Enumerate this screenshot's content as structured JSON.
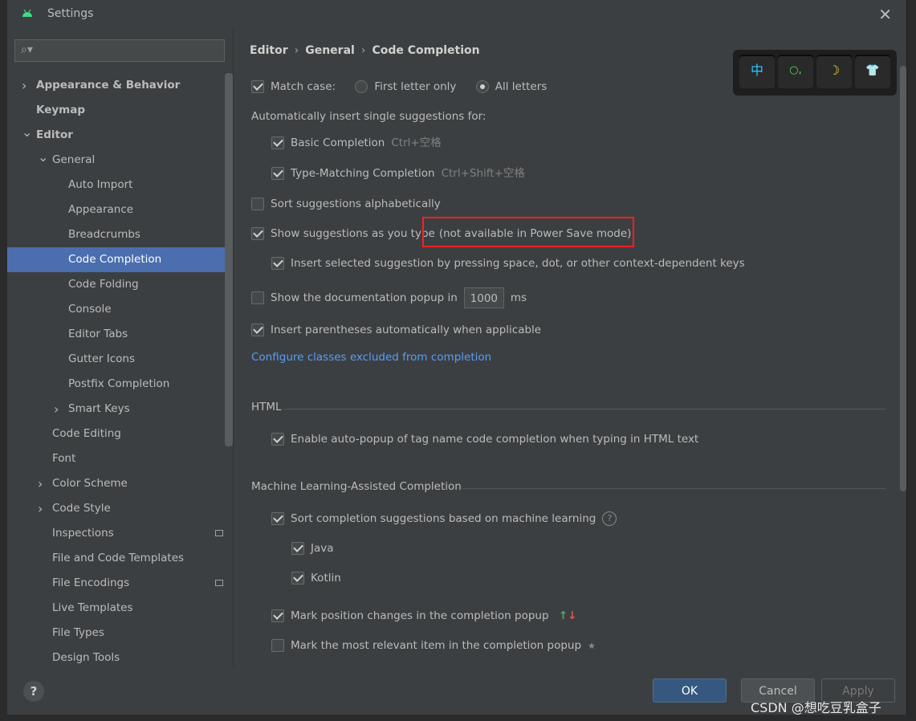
{
  "window": {
    "title": "Settings"
  },
  "search": {
    "placeholder": ""
  },
  "tree": [
    {
      "label": "Appearance & Behavior",
      "arrow": "›",
      "bold": true,
      "indent": 0
    },
    {
      "label": "Keymap",
      "arrow": "",
      "bold": true,
      "indent": 0
    },
    {
      "label": "Editor",
      "arrow": "⌄",
      "bold": true,
      "indent": 0
    },
    {
      "label": "General",
      "arrow": "⌄",
      "bold": false,
      "indent": 1
    },
    {
      "label": "Auto Import",
      "arrow": "",
      "bold": false,
      "indent": 2
    },
    {
      "label": "Appearance",
      "arrow": "",
      "bold": false,
      "indent": 2
    },
    {
      "label": "Breadcrumbs",
      "arrow": "",
      "bold": false,
      "indent": 2
    },
    {
      "label": "Code Completion",
      "arrow": "",
      "bold": false,
      "indent": 2,
      "selected": true
    },
    {
      "label": "Code Folding",
      "arrow": "",
      "bold": false,
      "indent": 2
    },
    {
      "label": "Console",
      "arrow": "",
      "bold": false,
      "indent": 2
    },
    {
      "label": "Editor Tabs",
      "arrow": "",
      "bold": false,
      "indent": 2
    },
    {
      "label": "Gutter Icons",
      "arrow": "",
      "bold": false,
      "indent": 2
    },
    {
      "label": "Postfix Completion",
      "arrow": "",
      "bold": false,
      "indent": 2
    },
    {
      "label": "Smart Keys",
      "arrow": "›",
      "bold": false,
      "indent": 2
    },
    {
      "label": "Code Editing",
      "arrow": "",
      "bold": false,
      "indent": 1
    },
    {
      "label": "Font",
      "arrow": "",
      "bold": false,
      "indent": 1
    },
    {
      "label": "Color Scheme",
      "arrow": "›",
      "bold": false,
      "indent": 1
    },
    {
      "label": "Code Style",
      "arrow": "›",
      "bold": false,
      "indent": 1
    },
    {
      "label": "Inspections",
      "arrow": "",
      "bold": false,
      "indent": 1,
      "icon": true
    },
    {
      "label": "File and Code Templates",
      "arrow": "",
      "bold": false,
      "indent": 1
    },
    {
      "label": "File Encodings",
      "arrow": "",
      "bold": false,
      "indent": 1,
      "icon": true
    },
    {
      "label": "Live Templates",
      "arrow": "",
      "bold": false,
      "indent": 1
    },
    {
      "label": "File Types",
      "arrow": "",
      "bold": false,
      "indent": 1
    },
    {
      "label": "Design Tools",
      "arrow": "",
      "bold": false,
      "indent": 1
    }
  ],
  "breadcrumb": [
    "Editor",
    "General",
    "Code Completion"
  ],
  "content": {
    "match_case": "Match case:",
    "first_letter": "First letter only",
    "all_letters": "All letters",
    "auto_insert": "Automatically insert single suggestions for:",
    "basic": "Basic Completion",
    "basic_hint": "Ctrl+空格",
    "type_matching": "Type-Matching Completion",
    "type_matching_hint": "Ctrl+Shift+空格",
    "sort_alpha": "Sort suggestions alphabetically",
    "show_suggestions": "Show suggestions as you type",
    "power_save": "(not available in Power Save mode)",
    "insert_selected": "Insert selected suggestion by pressing space, dot, or other context-dependent keys",
    "show_doc_pre": "Show the documentation popup in",
    "show_doc_value": "1000",
    "show_doc_unit": "ms",
    "insert_paren": "Insert parentheses automatically when applicable",
    "configure_link": "Configure classes excluded from completion",
    "html_section": "HTML",
    "html_autopopup": "Enable auto-popup of tag name code completion when typing in HTML text",
    "ml_section": "Machine Learning-Assisted Completion",
    "ml_sort": "Sort completion suggestions based on machine learning",
    "java": "Java",
    "kotlin": "Kotlin",
    "mark_position": "Mark position changes in the completion popup",
    "mark_relevant": "Mark the most relevant item in the completion popup"
  },
  "ime": {
    "keys": [
      "中",
      "○,",
      "☽",
      "👕"
    ]
  },
  "footer": {
    "ok": "OK",
    "cancel": "Cancel",
    "apply": "Apply"
  },
  "watermark": "CSDN @想吃豆乳盒子"
}
